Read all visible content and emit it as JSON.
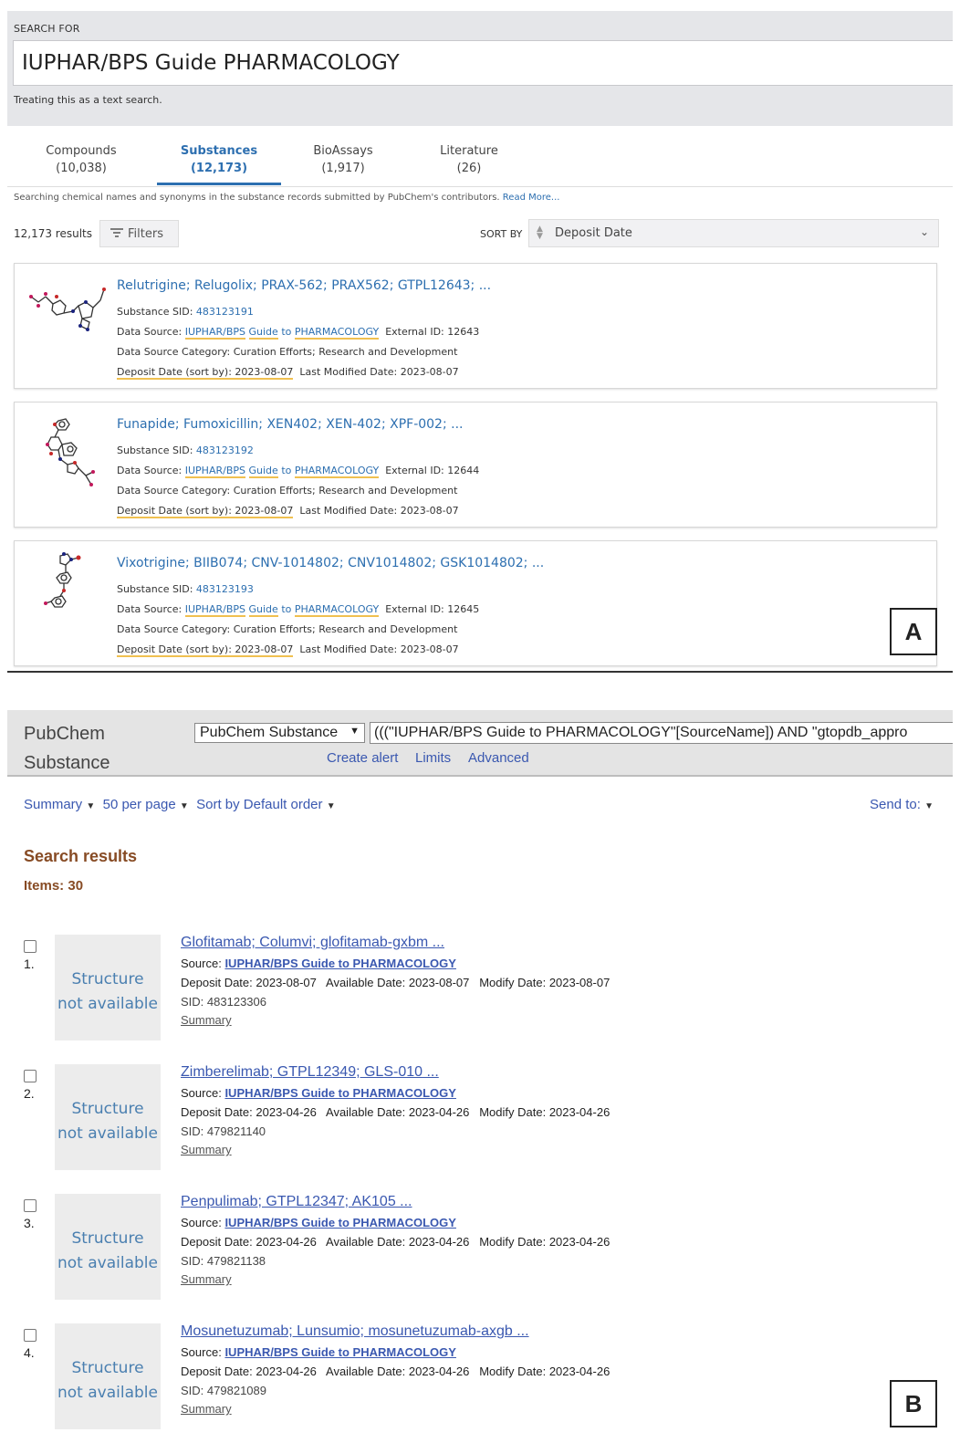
{
  "panelA": {
    "search_label": "SEARCH FOR",
    "search_value": "IUPHAR/BPS Guide PHARMACOLOGY",
    "treat_note": "Treating this as a text search.",
    "tabs": [
      {
        "label": "Compounds",
        "count": "(10,038)"
      },
      {
        "label": "Substances",
        "count": "(12,173)"
      },
      {
        "label": "BioAssays",
        "count": "(1,917)"
      },
      {
        "label": "Literature",
        "count": "(26)"
      }
    ],
    "note_text": "Searching chemical names and synonyms in the substance records submitted by PubChem's contributors.",
    "note_link": "Read More...",
    "results_count": "12,173 results",
    "filters_label": "Filters",
    "sort_by_label": "SORT BY",
    "sort_value": "Deposit Date",
    "labels": {
      "sid": "Substance SID:",
      "data_source": "Data Source:",
      "source_name": [
        "IUPHAR/BPS",
        "Guide",
        "to",
        "PHARMACOLOGY"
      ],
      "external_id": "External ID:",
      "category_label": "Data Source Category:",
      "category": "Curation Efforts; Research and Development",
      "deposit_date": "Deposit Date (sort by):",
      "last_modified": "Last Modified Date:"
    },
    "results": [
      {
        "title": "Relutrigine; Relugolix; PRAX-562; PRAX562; GTPL12643; ...",
        "sid": "483123191",
        "external_id": "12643",
        "deposit": "2023-08-07",
        "modified": "2023-08-07"
      },
      {
        "title": "Funapide; Fumoxicillin; XEN402; XEN-402; XPF-002; ...",
        "sid": "483123192",
        "external_id": "12644",
        "deposit": "2023-08-07",
        "modified": "2023-08-07"
      },
      {
        "title": "Vixotrigine; BIIB074; CNV-1014802; CNV1014802; GSK1014802; ...",
        "sid": "483123193",
        "external_id": "12645",
        "deposit": "2023-08-07",
        "modified": "2023-08-07"
      }
    ],
    "panel_letter": "A"
  },
  "panelB": {
    "brand_line1": "PubChem",
    "brand_line2": "Substance",
    "db_select": "PubChem Substance",
    "query": "(((\"IUPHAR/BPS Guide to PHARMACOLOGY\"[SourceName]) AND \"gtopdb_appro",
    "links": [
      "Create alert",
      "Limits",
      "Advanced"
    ],
    "toolbar": {
      "summary": "Summary",
      "per_page": "50 per page",
      "sort": "Sort by Default order",
      "send_to": "Send to:"
    },
    "heading": "Search results",
    "items_count": "Items: 30",
    "labels": {
      "source": "Source:",
      "source_name": "IUPHAR/BPS Guide to PHARMACOLOGY",
      "deposit": "Deposit Date:",
      "available": "Available Date:",
      "modify": "Modify Date:",
      "sid": "SID:",
      "summary_link": "Summary",
      "structure_line1": "Structure",
      "structure_line2": "not available"
    },
    "results": [
      {
        "num": "1.",
        "title": "Glofitamab; Columvi; glofitamab-gxbm ...",
        "deposit": "2023-08-07",
        "available": "2023-08-07",
        "modify": "2023-08-07",
        "sid": "483123306"
      },
      {
        "num": "2.",
        "title": "Zimberelimab; GTPL12349; GLS-010 ...",
        "deposit": "2023-04-26",
        "available": "2023-04-26",
        "modify": "2023-04-26",
        "sid": "479821140"
      },
      {
        "num": "3.",
        "title": "Penpulimab; GTPL12347; AK105 ...",
        "deposit": "2023-04-26",
        "available": "2023-04-26",
        "modify": "2023-04-26",
        "sid": "479821138"
      },
      {
        "num": "4.",
        "title": "Mosunetuzumab; Lunsumio; mosunetuzumab-axgb ...",
        "deposit": "2023-04-26",
        "available": "2023-04-26",
        "modify": "2023-04-26",
        "sid": "479821089"
      }
    ],
    "panel_letter": "B"
  }
}
